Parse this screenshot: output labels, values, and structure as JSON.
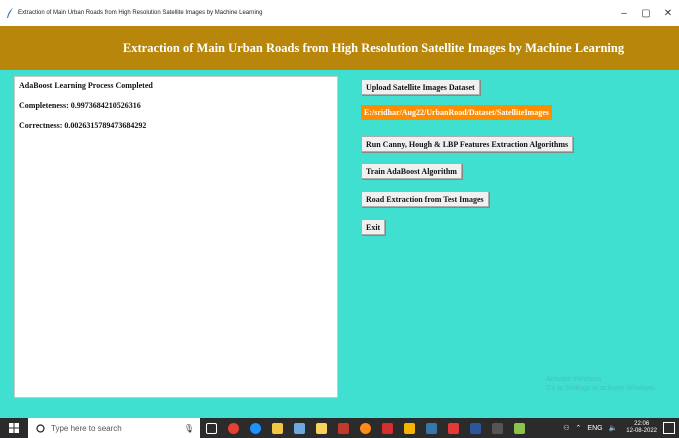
{
  "window": {
    "title": "Extraction of Main Urban Roads from High Resolution Satellite Images by Machine Learning",
    "minimize": "–",
    "maximize": "▢",
    "close": "✕"
  },
  "header": {
    "heading": "Extraction of Main Urban Roads from High Resolution Satellite Images by Machine Learning"
  },
  "output": {
    "lines": [
      "AdaBoost Learning Process Completed",
      "Completeness: 0.9973684210526316",
      "Correctness: 0.0026315789473684292"
    ]
  },
  "buttons": {
    "upload": "Upload Satellite Images Dataset",
    "path": "E:/sridhar/Aug22/UrbanRoad/Dataset/SatelliteImages",
    "features": "Run Canny, Hough & LBP Features Extraction Algorithms",
    "train": "Train AdaBoost Algorithm",
    "road": "Road Extraction from Test Images",
    "exit": "Exit"
  },
  "watermark": {
    "line1": "Activate Windows",
    "line2": "Go to Settings to activate Windows."
  },
  "taskbar": {
    "search_placeholder": "Type here to search",
    "mic": "🎙",
    "tray": {
      "language": "ENG",
      "time": "22:06",
      "date": "12-08-2022"
    }
  },
  "colors": {
    "background": "#40e0d0",
    "header": "#b8860b",
    "path_label": "#ff8c00"
  }
}
